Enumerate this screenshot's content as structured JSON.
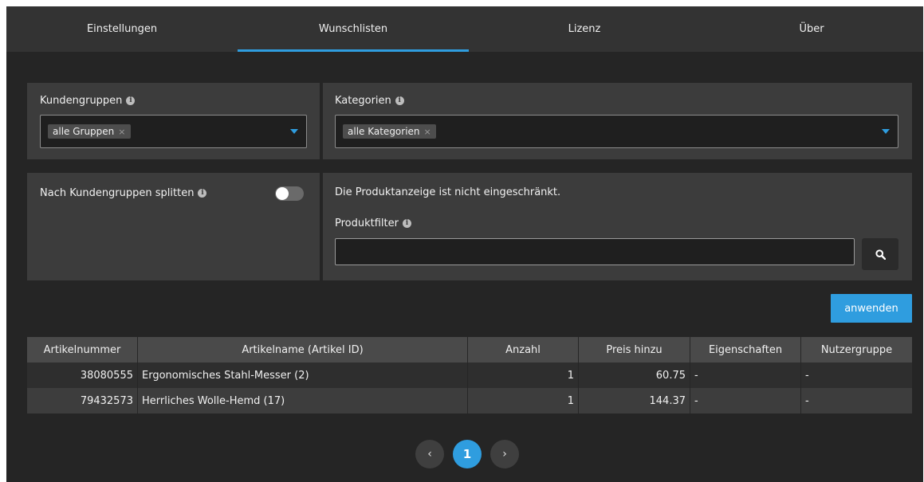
{
  "tabs": [
    {
      "label": "Einstellungen",
      "active": false
    },
    {
      "label": "Wunschlisten",
      "active": true
    },
    {
      "label": "Lizenz",
      "active": false
    },
    {
      "label": "Über",
      "active": false
    }
  ],
  "customer_groups": {
    "label": "Kundengruppen",
    "selected_chip": "alle Gruppen",
    "chip_remove": "×"
  },
  "categories": {
    "label": "Kategorien",
    "selected_chip": "alle Kategorien",
    "chip_remove": "×"
  },
  "split": {
    "label": "Nach Kundengruppen splitten",
    "enabled": false
  },
  "product_filter": {
    "status_text": "Die Produktanzeige ist nicht eingeschränkt.",
    "label": "Produktfilter",
    "value": "",
    "placeholder": ""
  },
  "apply_button": "anwenden",
  "table": {
    "headers": [
      "Artikelnummer",
      "Artikelname (Artikel ID)",
      "Anzahl",
      "Preis hinzu",
      "Eigenschaften",
      "Nutzergruppe"
    ],
    "rows": [
      {
        "number": "38080555",
        "name": "Ergonomisches Stahl-Messer (2)",
        "qty": "1",
        "price": "60.75",
        "props": "-",
        "group": "-"
      },
      {
        "number": "79432573",
        "name": "Herrliches Wolle-Hemd (17)",
        "qty": "1",
        "price": "144.37",
        "props": "-",
        "group": "-"
      }
    ]
  },
  "pagination": {
    "prev": "‹",
    "current": "1",
    "next": "›"
  },
  "colors": {
    "accent": "#2f9ddf",
    "background": "#252525",
    "panel": "#3c3c3c"
  },
  "icons": {
    "info": "info-icon",
    "caret": "caret-down-icon",
    "search": "search-icon",
    "remove": "close-icon"
  }
}
